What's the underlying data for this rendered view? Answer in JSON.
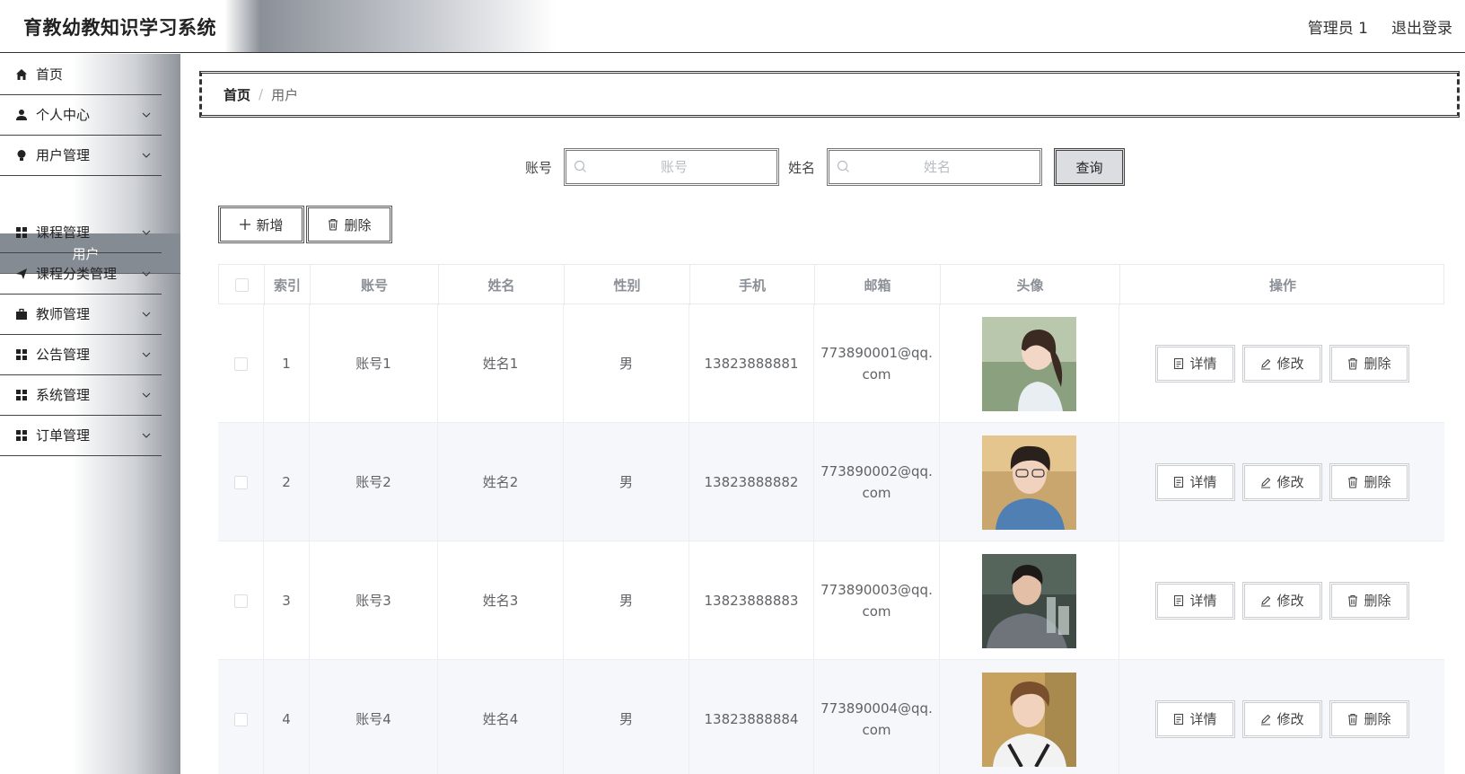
{
  "app": {
    "title": "育教幼教知识学习系统"
  },
  "header": {
    "user": "管理员 1",
    "logout": "退出登录"
  },
  "sidebar": {
    "items": [
      {
        "label": "首页",
        "icon": "home-icon"
      },
      {
        "label": "个人中心",
        "icon": "user-icon"
      },
      {
        "label": "用户管理",
        "icon": "bulb-icon"
      },
      {
        "label": "课程管理",
        "icon": "grid-icon"
      },
      {
        "label": "课程分类管理",
        "icon": "send-icon"
      },
      {
        "label": "教师管理",
        "icon": "briefcase-icon"
      },
      {
        "label": "公告管理",
        "icon": "grid-icon"
      },
      {
        "label": "系统管理",
        "icon": "grid-icon"
      },
      {
        "label": "订单管理",
        "icon": "grid-icon"
      }
    ],
    "active_sub": "用户"
  },
  "breadcrumb": {
    "home": "首页",
    "sep": "/",
    "current": "用户"
  },
  "search": {
    "account_label": "账号",
    "account_placeholder": "账号",
    "name_label": "姓名",
    "name_placeholder": "姓名",
    "query_button": "查询"
  },
  "actions": {
    "add": "新增",
    "delete": "删除"
  },
  "table": {
    "headers": [
      "索引",
      "账号",
      "姓名",
      "性别",
      "手机",
      "邮箱",
      "头像",
      "操作"
    ],
    "rows": [
      {
        "index": "1",
        "account": "账号1",
        "name": "姓名1",
        "gender": "男",
        "phone": "13823888881",
        "email": "773890001@qq.com"
      },
      {
        "index": "2",
        "account": "账号2",
        "name": "姓名2",
        "gender": "男",
        "phone": "13823888882",
        "email": "773890002@qq.com"
      },
      {
        "index": "3",
        "account": "账号3",
        "name": "姓名3",
        "gender": "男",
        "phone": "13823888883",
        "email": "773890003@qq.com"
      },
      {
        "index": "4",
        "account": "账号4",
        "name": "姓名4",
        "gender": "男",
        "phone": "13823888884",
        "email": "773890004@qq.com"
      }
    ],
    "row_actions": {
      "detail": "详情",
      "edit": "修改",
      "delete": "删除"
    }
  },
  "colors": {
    "accent_gray": "#858b93",
    "header_gradient": "#8b9098"
  }
}
